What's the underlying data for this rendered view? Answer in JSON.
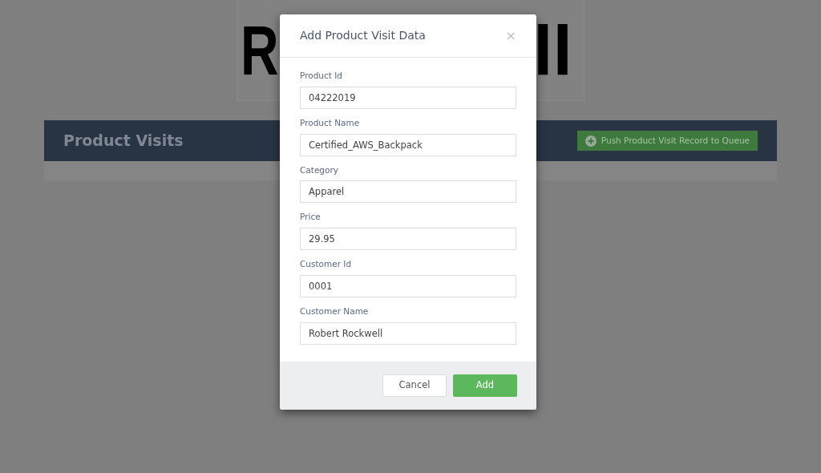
{
  "logo": {
    "left": "R",
    "right": "ll"
  },
  "panel": {
    "title": "Product Visits",
    "button": "Push Product Visit Record to Queue"
  },
  "modal": {
    "title": "Add Product Visit Data",
    "close": "×",
    "fields": [
      {
        "label": "Product Id",
        "value": "04222019"
      },
      {
        "label": "Product Name",
        "value": "Certified_AWS_Backpack"
      },
      {
        "label": "Category",
        "value": "Apparel"
      },
      {
        "label": "Price",
        "value": "29.95"
      },
      {
        "label": "Customer Id",
        "value": "0001"
      },
      {
        "label": "Customer Name",
        "value": "Robert Rockwell"
      }
    ],
    "buttons": [
      {
        "label": "Cancel",
        "kind": "secondary"
      },
      {
        "label": "Add",
        "kind": "primary"
      }
    ]
  }
}
